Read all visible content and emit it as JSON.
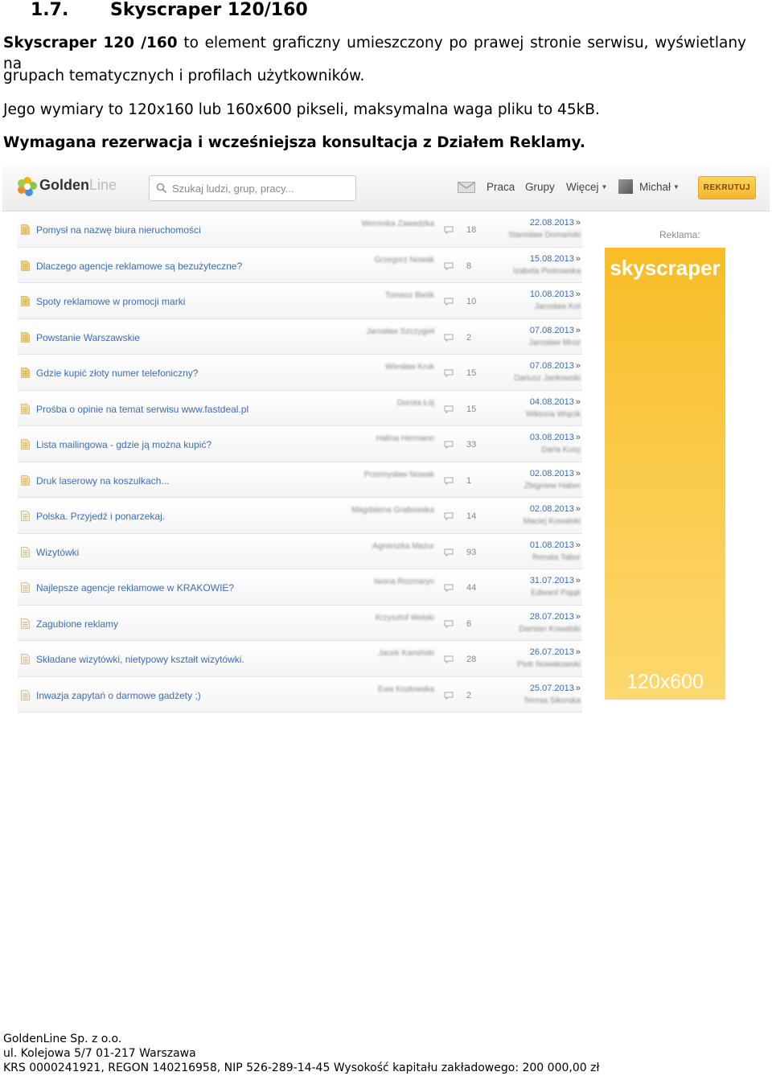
{
  "heading": {
    "number": "1.7.",
    "title": "Skyscraper 120/160"
  },
  "paragraphs": {
    "p1_bold": "Skyscraper 120 /160",
    "p1_rest": " to element graficzny umieszczony po prawej stronie serwisu, wyświetlany na",
    "p2": "grupach tematycznych i profilach użytkowników.",
    "p3": "Jego wymiary to 120x160 lub 160x600 pikseli, maksymalna waga pliku to 45kB.",
    "p4": "Wymagana rezerwacja i wcześniejsza konsultacja z Działem Reklamy."
  },
  "screenshot": {
    "logo": {
      "bold": "Golden",
      "light": "Line"
    },
    "search": {
      "placeholder": "Szukaj ludzi, grup, pracy..."
    },
    "nav": {
      "praca": "Praca",
      "grupy": "Grupy",
      "wiecej": "Więcej",
      "user": "Michał"
    },
    "recruit_label": "REKRUTUJ",
    "ad": {
      "label": "Reklama:",
      "headline": "skyscraper",
      "size": "120x600"
    },
    "brand_colors": {
      "ad_top": "#f8bd27",
      "ad_bottom": "#fdd86f",
      "link": "#3a6eb4",
      "button": "#f4b52c"
    },
    "rows": [
      {
        "topic": "Pomysł na nazwę biura nieruchomości",
        "author": "Weronika Zawadzka",
        "count": "18",
        "date": "22.08.2013",
        "lastby": "Stanisław Domański"
      },
      {
        "topic": "Dlaczego agencje reklamowe są bezużyteczne?",
        "author": "Grzegorz Nowak",
        "count": "8",
        "date": "15.08.2013",
        "lastby": "Izabela Piotrowska"
      },
      {
        "topic": "Spoty reklamowe w promocji marki",
        "author": "Tomasz Bielik",
        "count": "10",
        "date": "10.08.2013",
        "lastby": "Jarosław Kot"
      },
      {
        "topic": "Powstanie Warszawskie",
        "author": "Jarosław Szczygieł",
        "count": "2",
        "date": "07.08.2013",
        "lastby": "Jarosław Mroz"
      },
      {
        "topic": "Gdzie kupić złoty numer telefoniczny?",
        "author": "Wiesław Kruk",
        "count": "15",
        "date": "07.08.2013",
        "lastby": "Dariusz Jankowski"
      },
      {
        "topic": "Prośba o opinie na temat serwisu www.fastdeal.pl",
        "author": "Dorota Łój",
        "count": "15",
        "date": "04.08.2013",
        "lastby": "Wiktoria Wojcik"
      },
      {
        "topic": "Lista mailingowa - gdzie ją można kupić?",
        "author": "Halina Hermann",
        "count": "33",
        "date": "03.08.2013",
        "lastby": "Daria Kusy"
      },
      {
        "topic": "Druk laserowy na koszulkach...",
        "author": "Przemysław Nowak",
        "count": "1",
        "date": "02.08.2013",
        "lastby": "Zbigniew Haber"
      },
      {
        "topic": "Polska. Przyjedź i ponarzekaj.",
        "author": "Magdalena Grabowska",
        "count": "14",
        "date": "02.08.2013",
        "lastby": "Maciej Kowalski"
      },
      {
        "topic": "Wizytówki",
        "author": "Agnieszka Mazur",
        "count": "93",
        "date": "01.08.2013",
        "lastby": "Renata Tabor"
      },
      {
        "topic": "Najlepsze agencje reklamowe w KRAKOWIE?",
        "author": "Iwona Rozmaryn",
        "count": "44",
        "date": "31.07.2013",
        "lastby": "Edward Pająk"
      },
      {
        "topic": "Zagubione reklamy",
        "author": "Krzysztof Wolski",
        "count": "6",
        "date": "28.07.2013",
        "lastby": "Damian Kowalski"
      },
      {
        "topic": "Składane wizytówki, nietypowy kształt wizytówki.",
        "author": "Jacek Kamiński",
        "count": "28",
        "date": "26.07.2013",
        "lastby": "Piotr Nowakowski"
      },
      {
        "topic": "Inwazja zapytań o darmowe gadżety ;)",
        "author": "Ewa Kozłowska",
        "count": "2",
        "date": "25.07.2013",
        "lastby": "Teresa Sikorska"
      }
    ]
  },
  "footer": {
    "line1": "GoldenLine Sp. z o.o.",
    "line2": "ul. Kolejowa 5/7  01-217 Warszawa",
    "line3": "KRS 0000241921, REGON 140216958, NIP 526-289-14-45 Wysokość kapitału zakładowego: 200 000,00 zł"
  }
}
